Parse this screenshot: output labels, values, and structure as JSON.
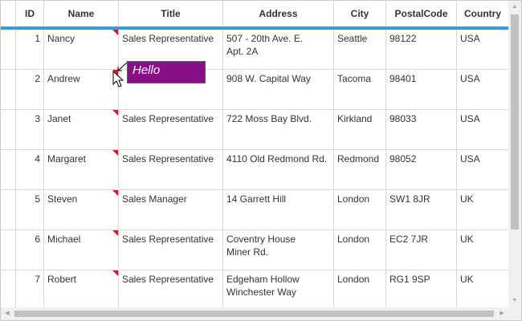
{
  "columns": [
    "",
    "ID",
    "Name",
    "Title",
    "Address",
    "City",
    "PostalCode",
    "Country"
  ],
  "rows": [
    {
      "id": "1",
      "name": "Nancy",
      "title": "Sales Representative",
      "address": "507 - 20th Ave. E.\nApt. 2A",
      "city": "Seattle",
      "postal": "98122",
      "country": "USA"
    },
    {
      "id": "2",
      "name": "Andrew",
      "title": "",
      "address": "908 W. Capital Way",
      "city": "Tacoma",
      "postal": "98401",
      "country": "USA"
    },
    {
      "id": "3",
      "name": "Janet",
      "title": "Sales Representative",
      "address": "722 Moss Bay Blvd.",
      "city": "Kirkland",
      "postal": "98033",
      "country": "USA"
    },
    {
      "id": "4",
      "name": "Margaret",
      "title": "Sales Representative",
      "address": "4110 Old Redmond Rd.",
      "city": "Redmond",
      "postal": "98052",
      "country": "USA"
    },
    {
      "id": "5",
      "name": "Steven",
      "title": "Sales Manager",
      "address": "14 Garrett Hill",
      "city": "London",
      "postal": "SW1 8JR",
      "country": "UK"
    },
    {
      "id": "6",
      "name": "Michael",
      "title": "Sales Representative",
      "address": "Coventry House\nMiner Rd.",
      "city": "London",
      "postal": "EC2 7JR",
      "country": "UK"
    },
    {
      "id": "7",
      "name": "Robert",
      "title": "Sales Representative",
      "address": "Edgeham Hollow\nWinchester Way",
      "city": "London",
      "postal": "RG1 9SP",
      "country": "UK"
    }
  ],
  "note": {
    "text": "Hello",
    "color": "#8a0d8a"
  },
  "colors": {
    "header_accent": "#3c9ad6",
    "note_flag": "#e81123"
  }
}
